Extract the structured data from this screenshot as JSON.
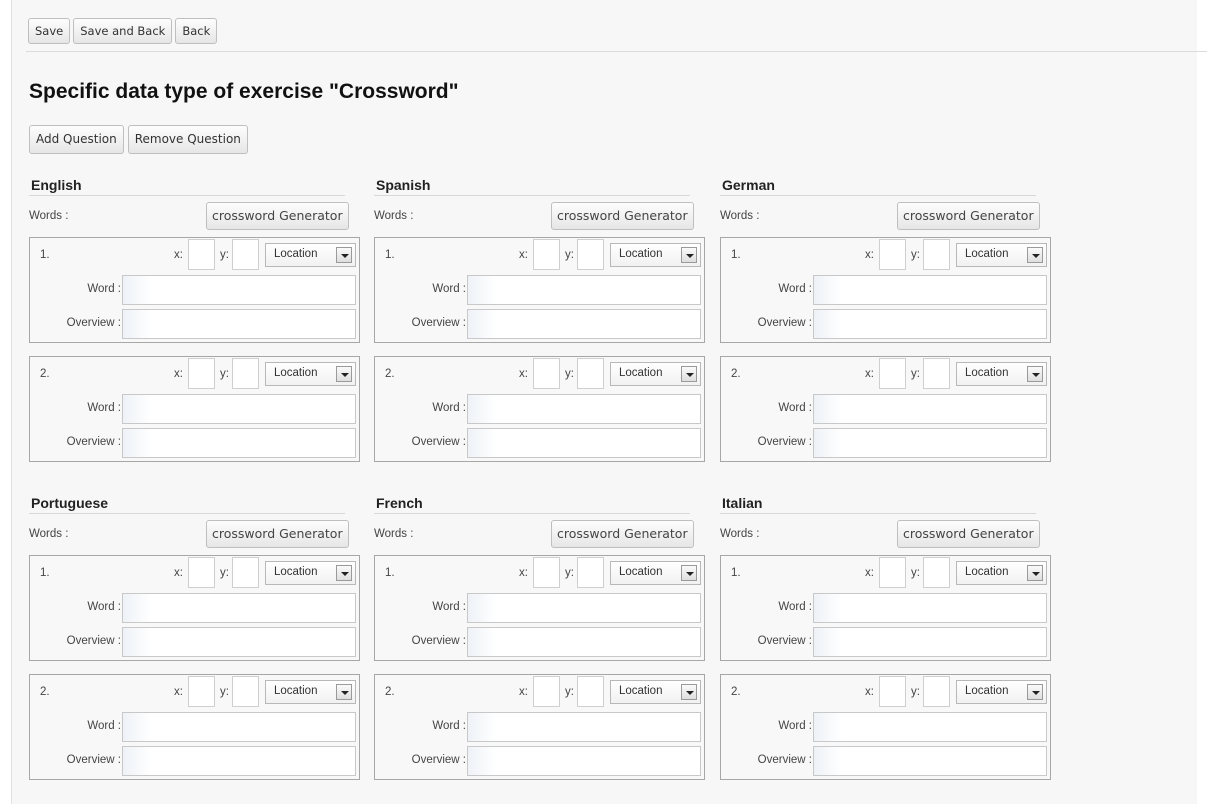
{
  "toolbar": {
    "save_label": "Save",
    "save_back_label": "Save and Back",
    "back_label": "Back"
  },
  "page_title": "Specific data type of exercise \"Crossword\"",
  "question_toolbar": {
    "add_label": "Add Question",
    "remove_label": "Remove Question"
  },
  "words_label": "Words :",
  "generator_label": "crossword Generator",
  "question": {
    "x_label": "x:",
    "y_label": "y:",
    "location_value": "Location",
    "word_label": "Word :",
    "overview_label": "Overview :",
    "numbers": [
      "1.",
      "2."
    ]
  },
  "languages": [
    "English",
    "Spanish",
    "German",
    "Portuguese",
    "French",
    "Italian"
  ]
}
